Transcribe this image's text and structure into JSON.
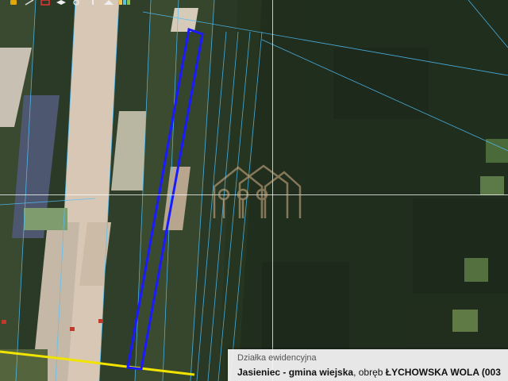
{
  "map": {
    "selected_parcel_color": "#1a1aff",
    "parcel_line_color": "#4fc3ff",
    "road_line_color": "#f1e300",
    "forest_color": "#1c2a1a",
    "field_light_color": "#c9b9a6"
  },
  "toolbar": {
    "icons": [
      "pan-icon",
      "measure-icon",
      "select-icon",
      "layers-icon",
      "zoom-icon",
      "info-icon",
      "print-icon",
      "legend-icon"
    ]
  },
  "info_panel": {
    "title": "Działka ewidencyjna",
    "gmina": "Jasieniec - gmina wiejska",
    "separator": ", obręb ",
    "obreb": "ŁYCHOWSKA WOLA (003"
  }
}
